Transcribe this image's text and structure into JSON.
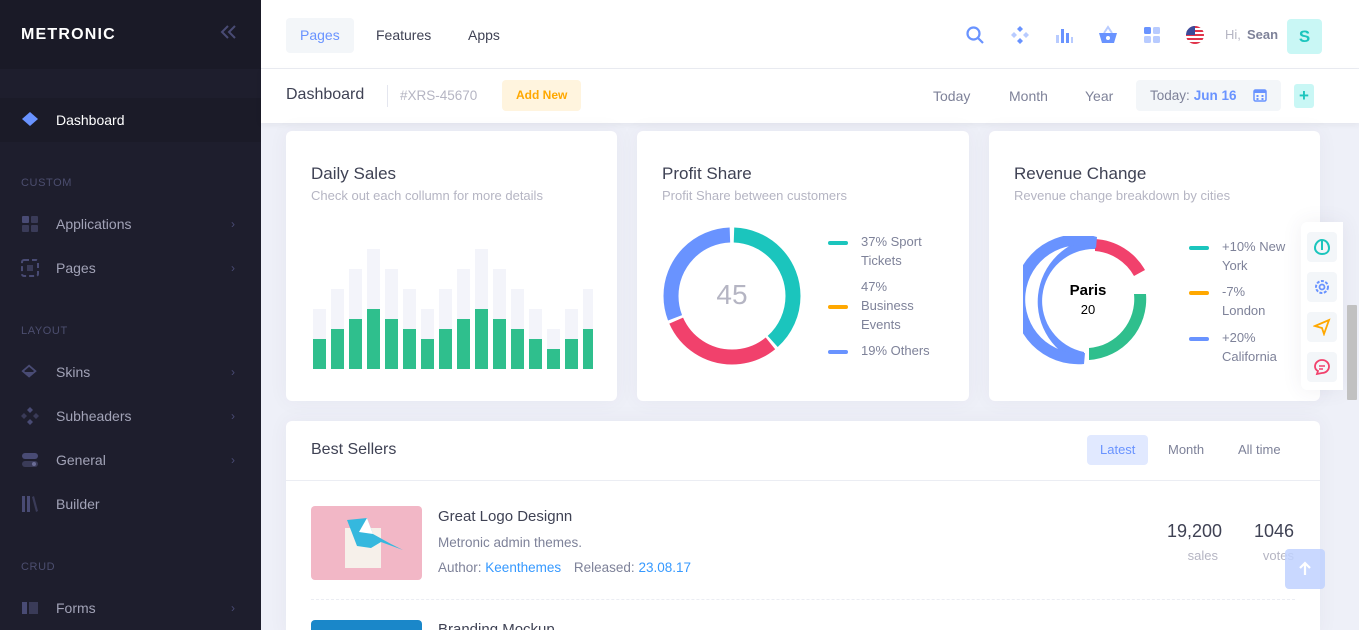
{
  "brand": {
    "name": "METRONIC"
  },
  "sidebar": {
    "dashboard": "Dashboard",
    "section_custom": "CUSTOM",
    "applications": "Applications",
    "pages": "Pages",
    "section_layout": "LAYOUT",
    "skins": "Skins",
    "subheaders": "Subheaders",
    "general": "General",
    "builder": "Builder",
    "section_crud": "CRUD",
    "forms": "Forms"
  },
  "header": {
    "tabs": [
      "Pages",
      "Features",
      "Apps"
    ],
    "greeting": "Hi,",
    "user_name": "Sean",
    "avatar_letter": "S",
    "icons": [
      "search-icon",
      "diamond-icon",
      "chart-bar-icon",
      "basket-icon",
      "grid-icon",
      "us-flag-icon"
    ]
  },
  "subheader": {
    "title": "Dashboard",
    "code": "#XRS-45670",
    "add_new": "Add New",
    "today": "Today",
    "month": "Month",
    "year": "Year",
    "date_label": "Today:",
    "date_value": "Jun 16",
    "plus": "+"
  },
  "daily_sales": {
    "title": "Daily Sales",
    "subtitle": "Check out each collumn for more details"
  },
  "profit_share": {
    "title": "Profit Share",
    "subtitle": "Profit Share between customers",
    "center_value": "45",
    "legend": [
      {
        "line1": "37% Sport",
        "line2": "Tickets",
        "color": "#1bc5bd"
      },
      {
        "line1": "47%",
        "line2": "Business",
        "line3": "Events",
        "color": "#ffa800"
      },
      {
        "line1": "19% Others",
        "color": "#6993ff"
      }
    ]
  },
  "revenue_change": {
    "title": "Revenue Change",
    "subtitle": "Revenue change breakdown by cities",
    "center_city": "Paris",
    "center_value": "20",
    "legend": [
      {
        "line1": "+10% New",
        "line2": "York",
        "color": "#1bc5bd"
      },
      {
        "line1": "-7%",
        "line2": "London",
        "color": "#ffa800"
      },
      {
        "line1": "+20%",
        "line2": "California",
        "color": "#6993ff"
      }
    ]
  },
  "best_sellers": {
    "title": "Best Sellers",
    "tabs": [
      "Latest",
      "Month",
      "All time"
    ],
    "item": {
      "title": "Great Logo Designn",
      "description": "Metronic admin themes.",
      "author_label": "Author:",
      "author": "Keenthemes",
      "released_label": "Released:",
      "released": "23.08.17",
      "sales_value": "19,200",
      "sales_label": "sales",
      "votes_value": "1046",
      "votes_label": "votes"
    },
    "next_item_title": "Branding Mockup"
  },
  "colors": {
    "primary": "#6993ff",
    "success": "#1bc5bd",
    "danger": "#f64e60",
    "pink": "#f1416c",
    "warning": "#ffa800",
    "sidebar_bg": "#1e1e2d"
  }
}
